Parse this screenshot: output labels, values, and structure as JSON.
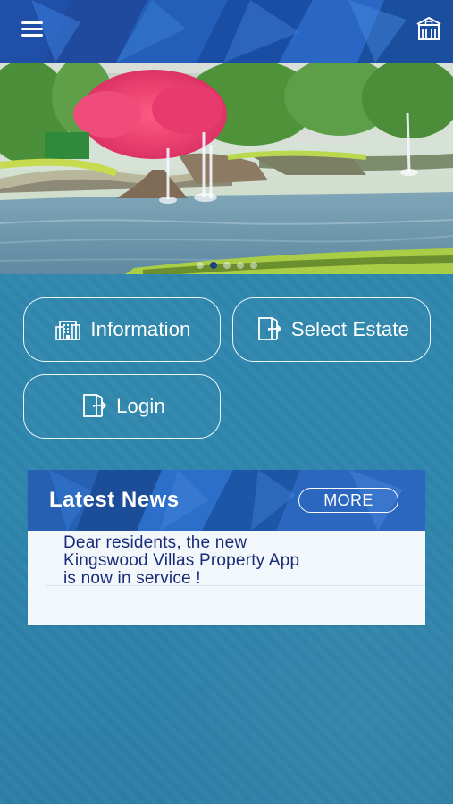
{
  "header": {
    "menu_icon": "menu-icon",
    "home_icon": "building-home-icon",
    "accent": "#1f56b0"
  },
  "hero": {
    "active_slide": 1,
    "slide_count": 5
  },
  "buttons": {
    "information": "Information",
    "select_estate": "Select Estate",
    "login": "Login"
  },
  "news": {
    "title": "Latest News",
    "more_label": "MORE",
    "items": [
      {
        "line1": "Dear residents, the new",
        "line2": "Kingswood Villas Property App",
        "line3": "is now in service !"
      }
    ]
  }
}
